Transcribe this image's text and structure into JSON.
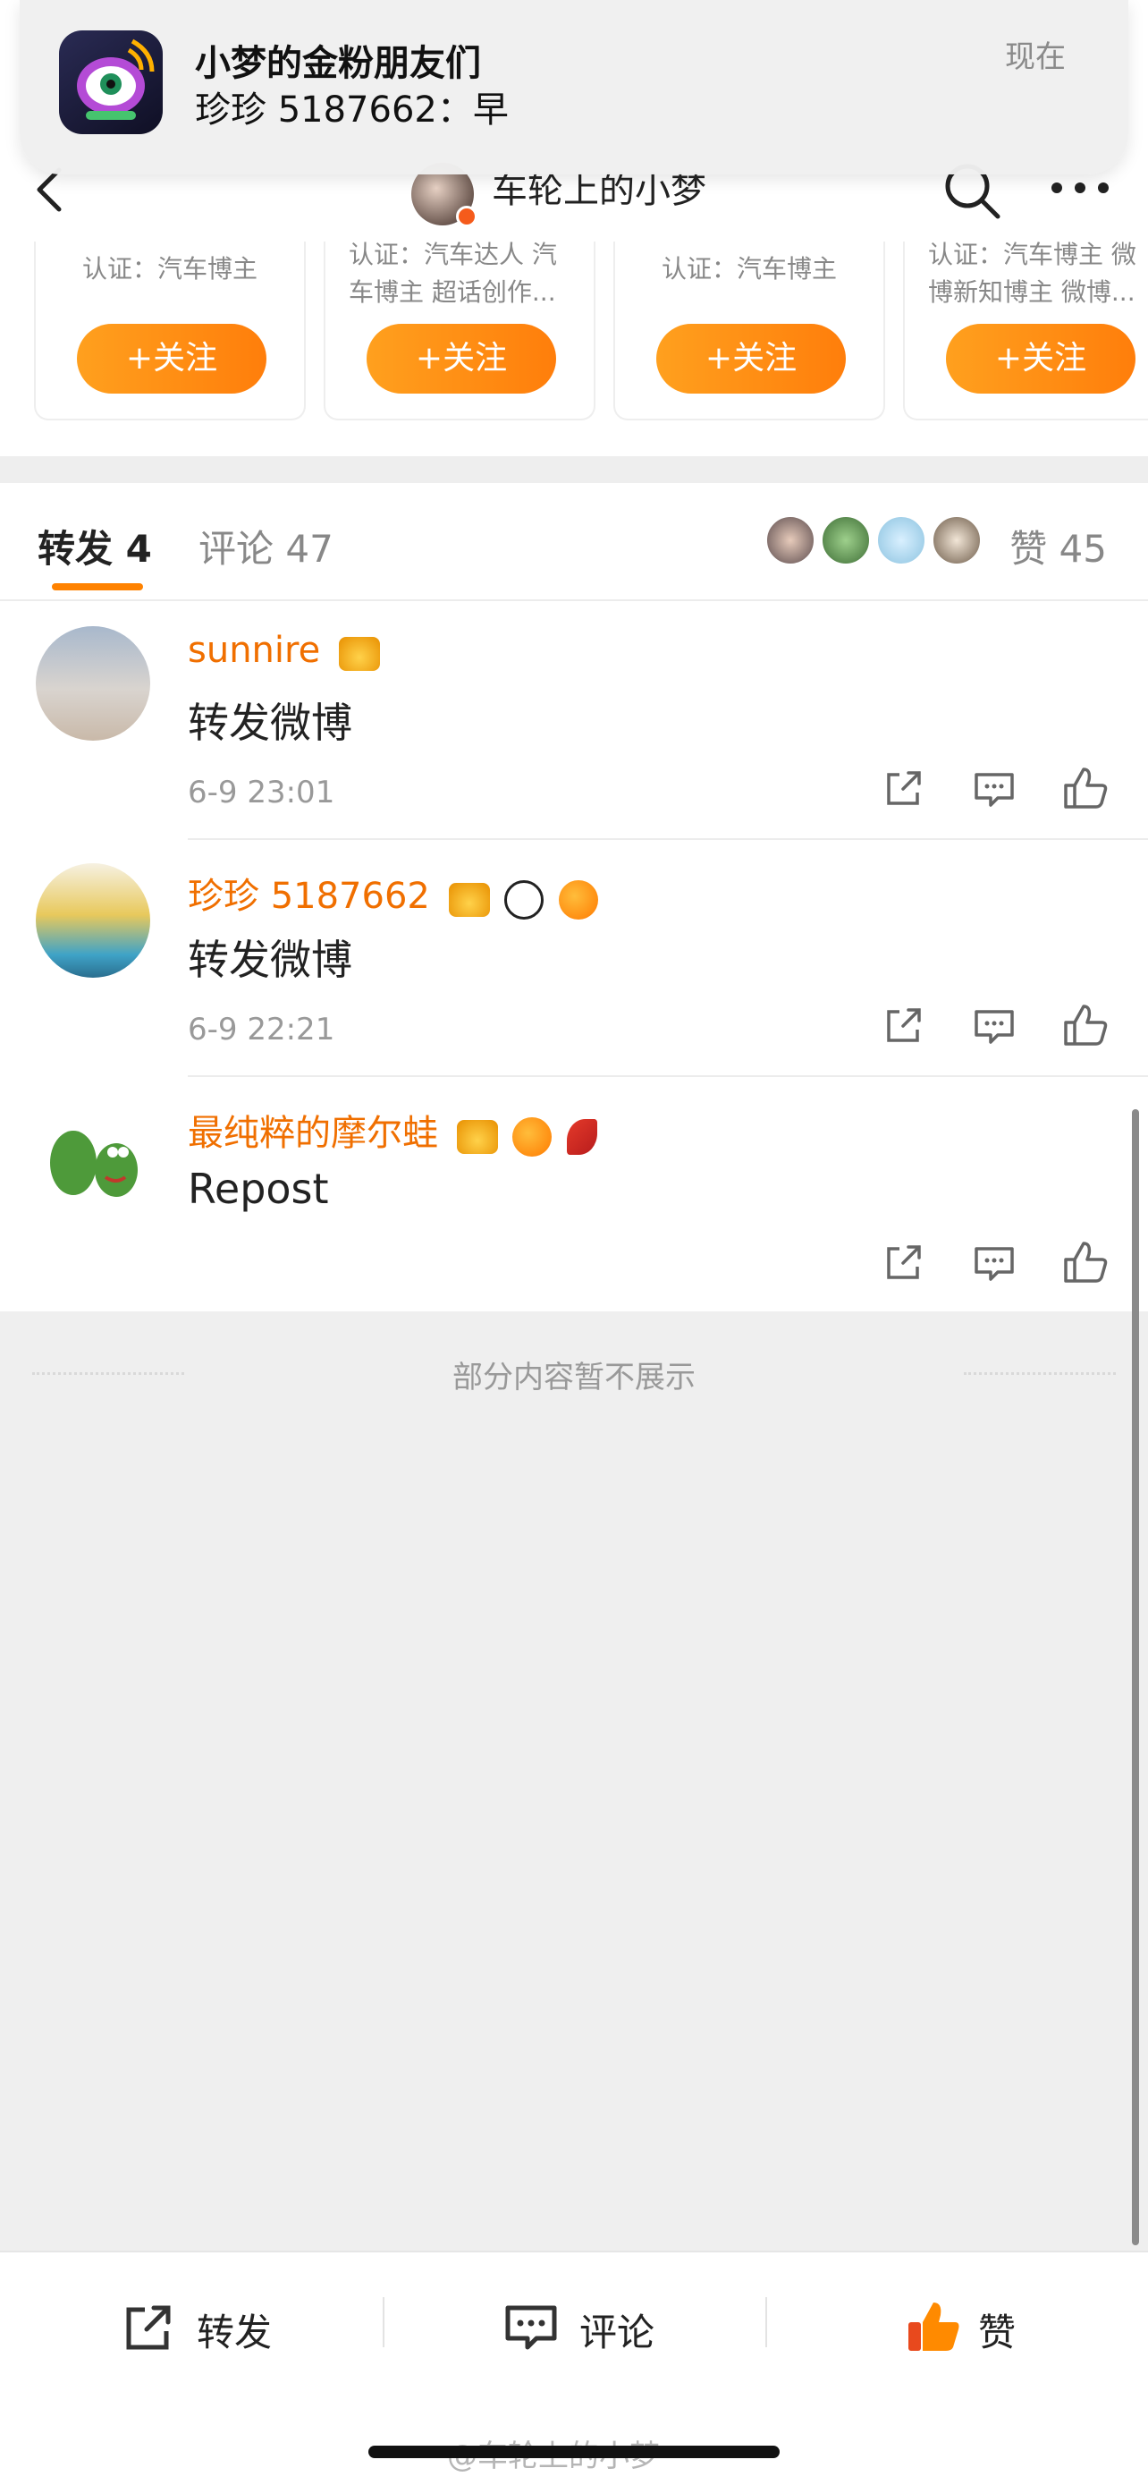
{
  "notification": {
    "title": "小梦的金粉朋友们",
    "body": "珍珍 5187662：早",
    "time": "现在",
    "icon": "app-icon"
  },
  "header": {
    "title": "车轮上的小梦",
    "back_icon": "chevron-left-icon",
    "search_icon": "search-icon",
    "more_icon": "more-dots-icon"
  },
  "recommend_cards": [
    {
      "desc": "认证：汽车博主",
      "follow_label": "+关注"
    },
    {
      "desc": "认证：汽车达人 汽车博主 超话创作...",
      "follow_label": "+关注"
    },
    {
      "desc": "认证：汽车博主",
      "follow_label": "+关注"
    },
    {
      "desc": "认证：汽车博主 微博新知博主 微博...",
      "follow_label": "+关注"
    }
  ],
  "tabs": {
    "repost": "转发 4",
    "comment": "评论 47",
    "like": "赞 45"
  },
  "reposts": [
    {
      "name": "sunnire",
      "content": "转发微博",
      "time": "6-9 23:01",
      "badges": [
        "crown"
      ]
    },
    {
      "name": "珍珍 5187662",
      "content": "转发微博",
      "time": "6-9 22:21",
      "badges": [
        "crown",
        "panda",
        "fish"
      ]
    },
    {
      "name": "最纯粹的摩尔蛙",
      "content": "Repost",
      "time": "",
      "badges": [
        "crown",
        "fish",
        "chili"
      ]
    }
  ],
  "more_note": "部分内容暂不展示",
  "bottom_bar": {
    "repost": "转发",
    "comment": "评论",
    "like": "赞"
  },
  "watermark": "@车轮上的小梦",
  "colors": {
    "accent": "#ff8200",
    "username": "#f06f00",
    "follow_gradient_start": "#ffa01e",
    "follow_gradient_end": "#ff7e0b"
  }
}
